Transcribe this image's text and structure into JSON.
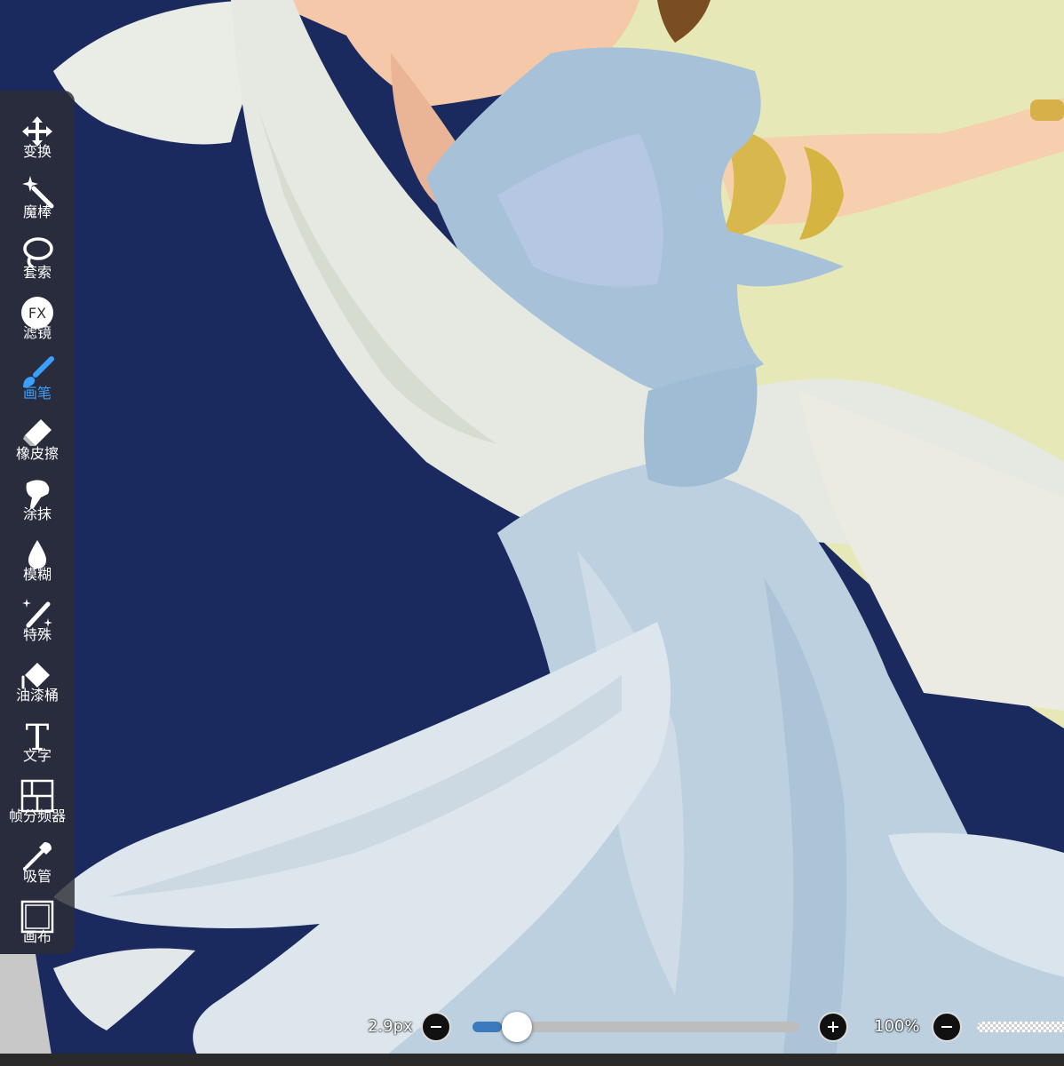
{
  "app": {
    "accent_color": "#3aa0ff",
    "canvas_background": "#1b2a5e"
  },
  "toolbar": {
    "active_tool": "brush",
    "tools": [
      {
        "id": "transform",
        "label": "变换",
        "icon": "move-arrows-icon"
      },
      {
        "id": "magic-wand",
        "label": "魔棒",
        "icon": "magic-wand-icon"
      },
      {
        "id": "lasso",
        "label": "套索",
        "icon": "lasso-icon"
      },
      {
        "id": "filter",
        "label": "滤镜",
        "icon": "fx-icon",
        "icon_text": "FX"
      },
      {
        "id": "brush",
        "label": "画笔",
        "icon": "brush-icon"
      },
      {
        "id": "eraser",
        "label": "橡皮擦",
        "icon": "eraser-icon"
      },
      {
        "id": "smudge",
        "label": "涂抹",
        "icon": "smudge-finger-icon"
      },
      {
        "id": "blur",
        "label": "模糊",
        "icon": "droplet-icon"
      },
      {
        "id": "special",
        "label": "特殊",
        "icon": "sparkle-pen-icon"
      },
      {
        "id": "fill",
        "label": "油漆桶",
        "icon": "paint-bucket-icon"
      },
      {
        "id": "text",
        "label": "文字",
        "icon": "text-icon",
        "icon_text": "T"
      },
      {
        "id": "frame-divider",
        "label": "帧分频器",
        "icon": "frame-divider-icon"
      },
      {
        "id": "eyedropper",
        "label": "吸管",
        "icon": "eyedropper-icon"
      },
      {
        "id": "canvas",
        "label": "画布",
        "icon": "canvas-icon"
      }
    ]
  },
  "bottom_controls": {
    "brush_size": "2.9px",
    "brush_size_slider_fraction": 0.09,
    "opacity": "100%"
  }
}
